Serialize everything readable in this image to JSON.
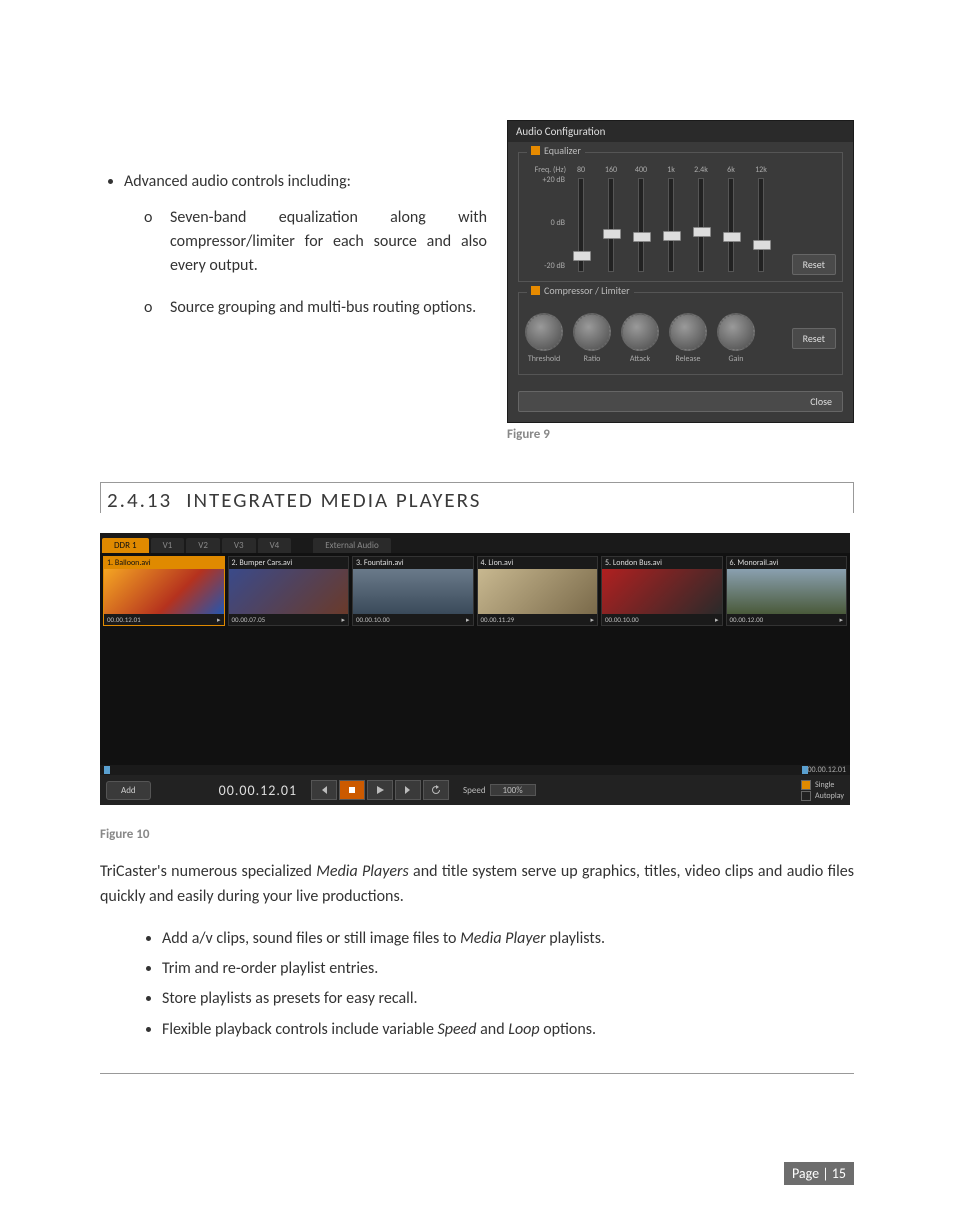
{
  "intro_bullet": "Advanced audio controls including:",
  "sub_bullets": [
    "Seven-band equalization along with compressor/limiter for each source and also every output.",
    "Source grouping and multi-bus routing options."
  ],
  "fig9": {
    "caption": "Figure 9",
    "panel_title": "Audio Configuration",
    "eq_group": "Equalizer",
    "freq_label": "Freq. (Hz)",
    "db_labels": [
      "+20 dB",
      "0 dB",
      "-20 dB"
    ],
    "bands": [
      {
        "hz": "80",
        "pos": 78
      },
      {
        "hz": "160",
        "pos": 54
      },
      {
        "hz": "400",
        "pos": 58
      },
      {
        "hz": "1k",
        "pos": 56
      },
      {
        "hz": "2.4k",
        "pos": 52
      },
      {
        "hz": "6k",
        "pos": 58
      },
      {
        "hz": "12k",
        "pos": 66
      }
    ],
    "reset": "Reset",
    "comp_group": "Compressor / Limiter",
    "knobs": [
      "Threshold",
      "Ratio",
      "Attack",
      "Release",
      "Gain"
    ],
    "close": "Close"
  },
  "section": {
    "number": "2.4.13",
    "title": "INTEGRATED MEDIA PLAYERS"
  },
  "fig10": {
    "caption": "Figure 10",
    "tabs": [
      {
        "label": "DDR 1",
        "active": true
      },
      {
        "label": "V1"
      },
      {
        "label": "V2"
      },
      {
        "label": "V3"
      },
      {
        "label": "V4"
      },
      {
        "label": "External Audio",
        "ext": true
      }
    ],
    "clips": [
      {
        "name": "1. Balloon.avi",
        "tc": "00.00.12.01",
        "sel": true,
        "color": "linear-gradient(135deg,#f5a623,#b5321e 60%,#2356b0)"
      },
      {
        "name": "2. Bumper Cars.avi",
        "tc": "00.00.07.05",
        "color": "linear-gradient(135deg,#3a4a8a,#6a3a2a)"
      },
      {
        "name": "3. Fountain.avi",
        "tc": "00.00.10.00",
        "color": "linear-gradient(180deg,#6a7a8a,#3a4a5a)"
      },
      {
        "name": "4. Lion.avi",
        "tc": "00.00.11.29",
        "color": "linear-gradient(135deg,#c8b890,#7a6a4a)"
      },
      {
        "name": "5. London Bus.avi",
        "tc": "00.00.10.00",
        "color": "linear-gradient(135deg,#b02020,#2a2a2a)"
      },
      {
        "name": "6. Monorail.avi",
        "tc": "00.00.12.00",
        "color": "linear-gradient(180deg,#8aa0b0,#4a5a3a)"
      }
    ],
    "scrub_tc": "00.00.12.01",
    "add": "Add",
    "main_tc": "00.00.12.01",
    "speed_label": "Speed",
    "speed_value": "100%",
    "single": "Single",
    "autoplay": "Autoplay"
  },
  "paragraph": "TriCaster's numerous specialized Media Players and title system serve up graphics, titles, video clips and audio files quickly and easily during your live productions.",
  "features": [
    "Add a/v clips, sound files or still image files to Media Player playlists.",
    "Trim and re-order playlist entries.",
    "Store playlists as presets for easy recall.",
    "Flexible playback controls include variable Speed and Loop options."
  ],
  "page_label": "Page | 15"
}
